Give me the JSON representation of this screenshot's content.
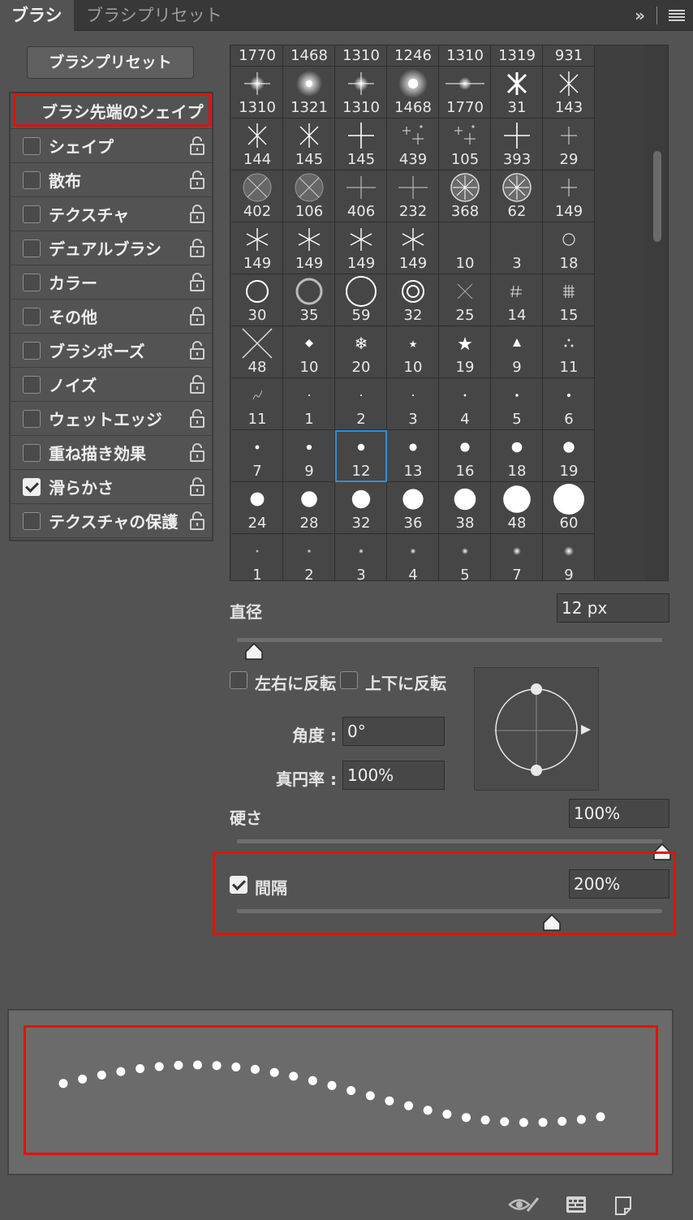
{
  "tabs": [
    {
      "label": "ブラシ",
      "active": true
    },
    {
      "label": "ブラシプリセット",
      "active": false
    }
  ],
  "preset_button": "ブラシプリセット",
  "options": [
    {
      "label": "ブラシ先端のシェイプ",
      "checkbox": false,
      "lock": false
    },
    {
      "label": "シェイプ",
      "checked": false,
      "lock": true
    },
    {
      "label": "散布",
      "checked": false,
      "lock": true
    },
    {
      "label": "テクスチャ",
      "checked": false,
      "lock": true
    },
    {
      "label": "デュアルブラシ",
      "checked": false,
      "lock": true
    },
    {
      "label": "カラー",
      "checked": false,
      "lock": true
    },
    {
      "label": "その他",
      "checked": false,
      "lock": true
    },
    {
      "label": "ブラシポーズ",
      "checked": false,
      "lock": true
    },
    {
      "label": "ノイズ",
      "checked": false,
      "lock": true
    },
    {
      "label": "ウェットエッジ",
      "checked": false,
      "lock": true
    },
    {
      "label": "重ね描き効果",
      "checked": false,
      "lock": true
    },
    {
      "label": "滑らかさ",
      "checked": true,
      "lock": true
    },
    {
      "label": "テクスチャの保護",
      "checked": false,
      "lock": true
    }
  ],
  "brush_grid": {
    "top_partial": [
      "1770",
      "1468",
      "1310",
      "1246",
      "1310",
      "1319",
      "931"
    ],
    "rows": [
      [
        {
          "n": "1310",
          "k": "star-glow"
        },
        {
          "n": "1321",
          "k": "glow-big"
        },
        {
          "n": "1310",
          "k": "star-glow"
        },
        {
          "n": "1468",
          "k": "glow-bigger"
        },
        {
          "n": "1770",
          "k": "flare"
        },
        {
          "n": "31",
          "k": "asterisk-bold"
        },
        {
          "n": "143",
          "k": "asterisk"
        }
      ],
      [
        {
          "n": "144",
          "k": "asterisk"
        },
        {
          "n": "145",
          "k": "asterisk"
        },
        {
          "n": "145",
          "k": "cross-thin"
        },
        {
          "n": "439",
          "k": "sparkles"
        },
        {
          "n": "105",
          "k": "sparkles"
        },
        {
          "n": "393",
          "k": "cross-thin"
        },
        {
          "n": "29",
          "k": "cross-small"
        }
      ],
      [
        {
          "n": "402",
          "k": "circle-x"
        },
        {
          "n": "106",
          "k": "circle-x"
        },
        {
          "n": "406",
          "k": "cross-hair"
        },
        {
          "n": "232",
          "k": "cross-hair"
        },
        {
          "n": "368",
          "k": "circle-star"
        },
        {
          "n": "62",
          "k": "circle-star"
        },
        {
          "n": "149",
          "k": "cross-small"
        }
      ],
      [
        {
          "n": "149",
          "k": "star6"
        },
        {
          "n": "149",
          "k": "star6"
        },
        {
          "n": "149",
          "k": "star6"
        },
        {
          "n": "149",
          "k": "star6"
        },
        {
          "n": "10",
          "k": "dot-soft"
        },
        {
          "n": "3",
          "k": "dot-tiny"
        },
        {
          "n": "18",
          "k": "ring-small"
        }
      ],
      [
        {
          "n": "30",
          "k": "ring-m"
        },
        {
          "n": "35",
          "k": "ring-soft"
        },
        {
          "n": "59",
          "k": "ring-l"
        },
        {
          "n": "32",
          "k": "ring-double"
        },
        {
          "n": "25",
          "k": "x-thin"
        },
        {
          "n": "14",
          "k": "hatch"
        },
        {
          "n": "15",
          "k": "grid-hash"
        }
      ],
      [
        {
          "n": "48",
          "k": "x-big"
        },
        {
          "n": "10",
          "k": "diamond"
        },
        {
          "n": "20",
          "k": "snowflake"
        },
        {
          "n": "10",
          "k": "star-small"
        },
        {
          "n": "19",
          "k": "star-solid"
        },
        {
          "n": "9",
          "k": "triangle"
        },
        {
          "n": "11",
          "k": "dots3"
        }
      ],
      [
        {
          "n": "11",
          "k": "squiggle"
        },
        {
          "n": "1",
          "k": "dot-1"
        },
        {
          "n": "2",
          "k": "dot-2"
        },
        {
          "n": "3",
          "k": "dot-3"
        },
        {
          "n": "4",
          "k": "dot-4"
        },
        {
          "n": "5",
          "k": "dot-5"
        },
        {
          "n": "6",
          "k": "dot-6"
        }
      ],
      [
        {
          "n": "7",
          "k": "dot-7"
        },
        {
          "n": "9",
          "k": "dot-9"
        },
        {
          "n": "12",
          "k": "dot-12",
          "selected": true
        },
        {
          "n": "13",
          "k": "dot-13"
        },
        {
          "n": "16",
          "k": "dot-16"
        },
        {
          "n": "18",
          "k": "dot-18"
        },
        {
          "n": "19",
          "k": "dot-19"
        }
      ],
      [
        {
          "n": "24",
          "k": "dot-24"
        },
        {
          "n": "28",
          "k": "dot-28"
        },
        {
          "n": "32",
          "k": "dot-32"
        },
        {
          "n": "36",
          "k": "dot-36"
        },
        {
          "n": "38",
          "k": "dot-38"
        },
        {
          "n": "48",
          "k": "dot-48"
        },
        {
          "n": "60",
          "k": "dot-60"
        }
      ],
      [
        {
          "n": "1",
          "k": "soft-1"
        },
        {
          "n": "2",
          "k": "soft-2"
        },
        {
          "n": "3",
          "k": "soft-3"
        },
        {
          "n": "4",
          "k": "soft-4"
        },
        {
          "n": "5",
          "k": "soft-5"
        },
        {
          "n": "7",
          "k": "soft-7"
        },
        {
          "n": "9",
          "k": "soft-9"
        }
      ]
    ]
  },
  "diameter": {
    "label": "直径",
    "value": "12 px",
    "slider_fraction": 0.04
  },
  "flip_x": {
    "label": "左右に反転",
    "checked": false
  },
  "flip_y": {
    "label": "上下に反転",
    "checked": false
  },
  "angle": {
    "label": "角度 :",
    "value": "0°"
  },
  "roundness": {
    "label": "真円率 :",
    "value": "100%"
  },
  "hardness": {
    "label": "硬さ",
    "value": "100%",
    "slider_fraction": 1.0
  },
  "spacing": {
    "label": "間隔",
    "value": "200%",
    "checked": true,
    "slider_fraction": 0.74
  },
  "bottom_icons": [
    "eye-brush-icon",
    "keyboard-icon",
    "new-preset-icon"
  ],
  "colors": {
    "panel": "#535353",
    "highlight": "#e3120b",
    "selection": "#2f8fd6"
  }
}
